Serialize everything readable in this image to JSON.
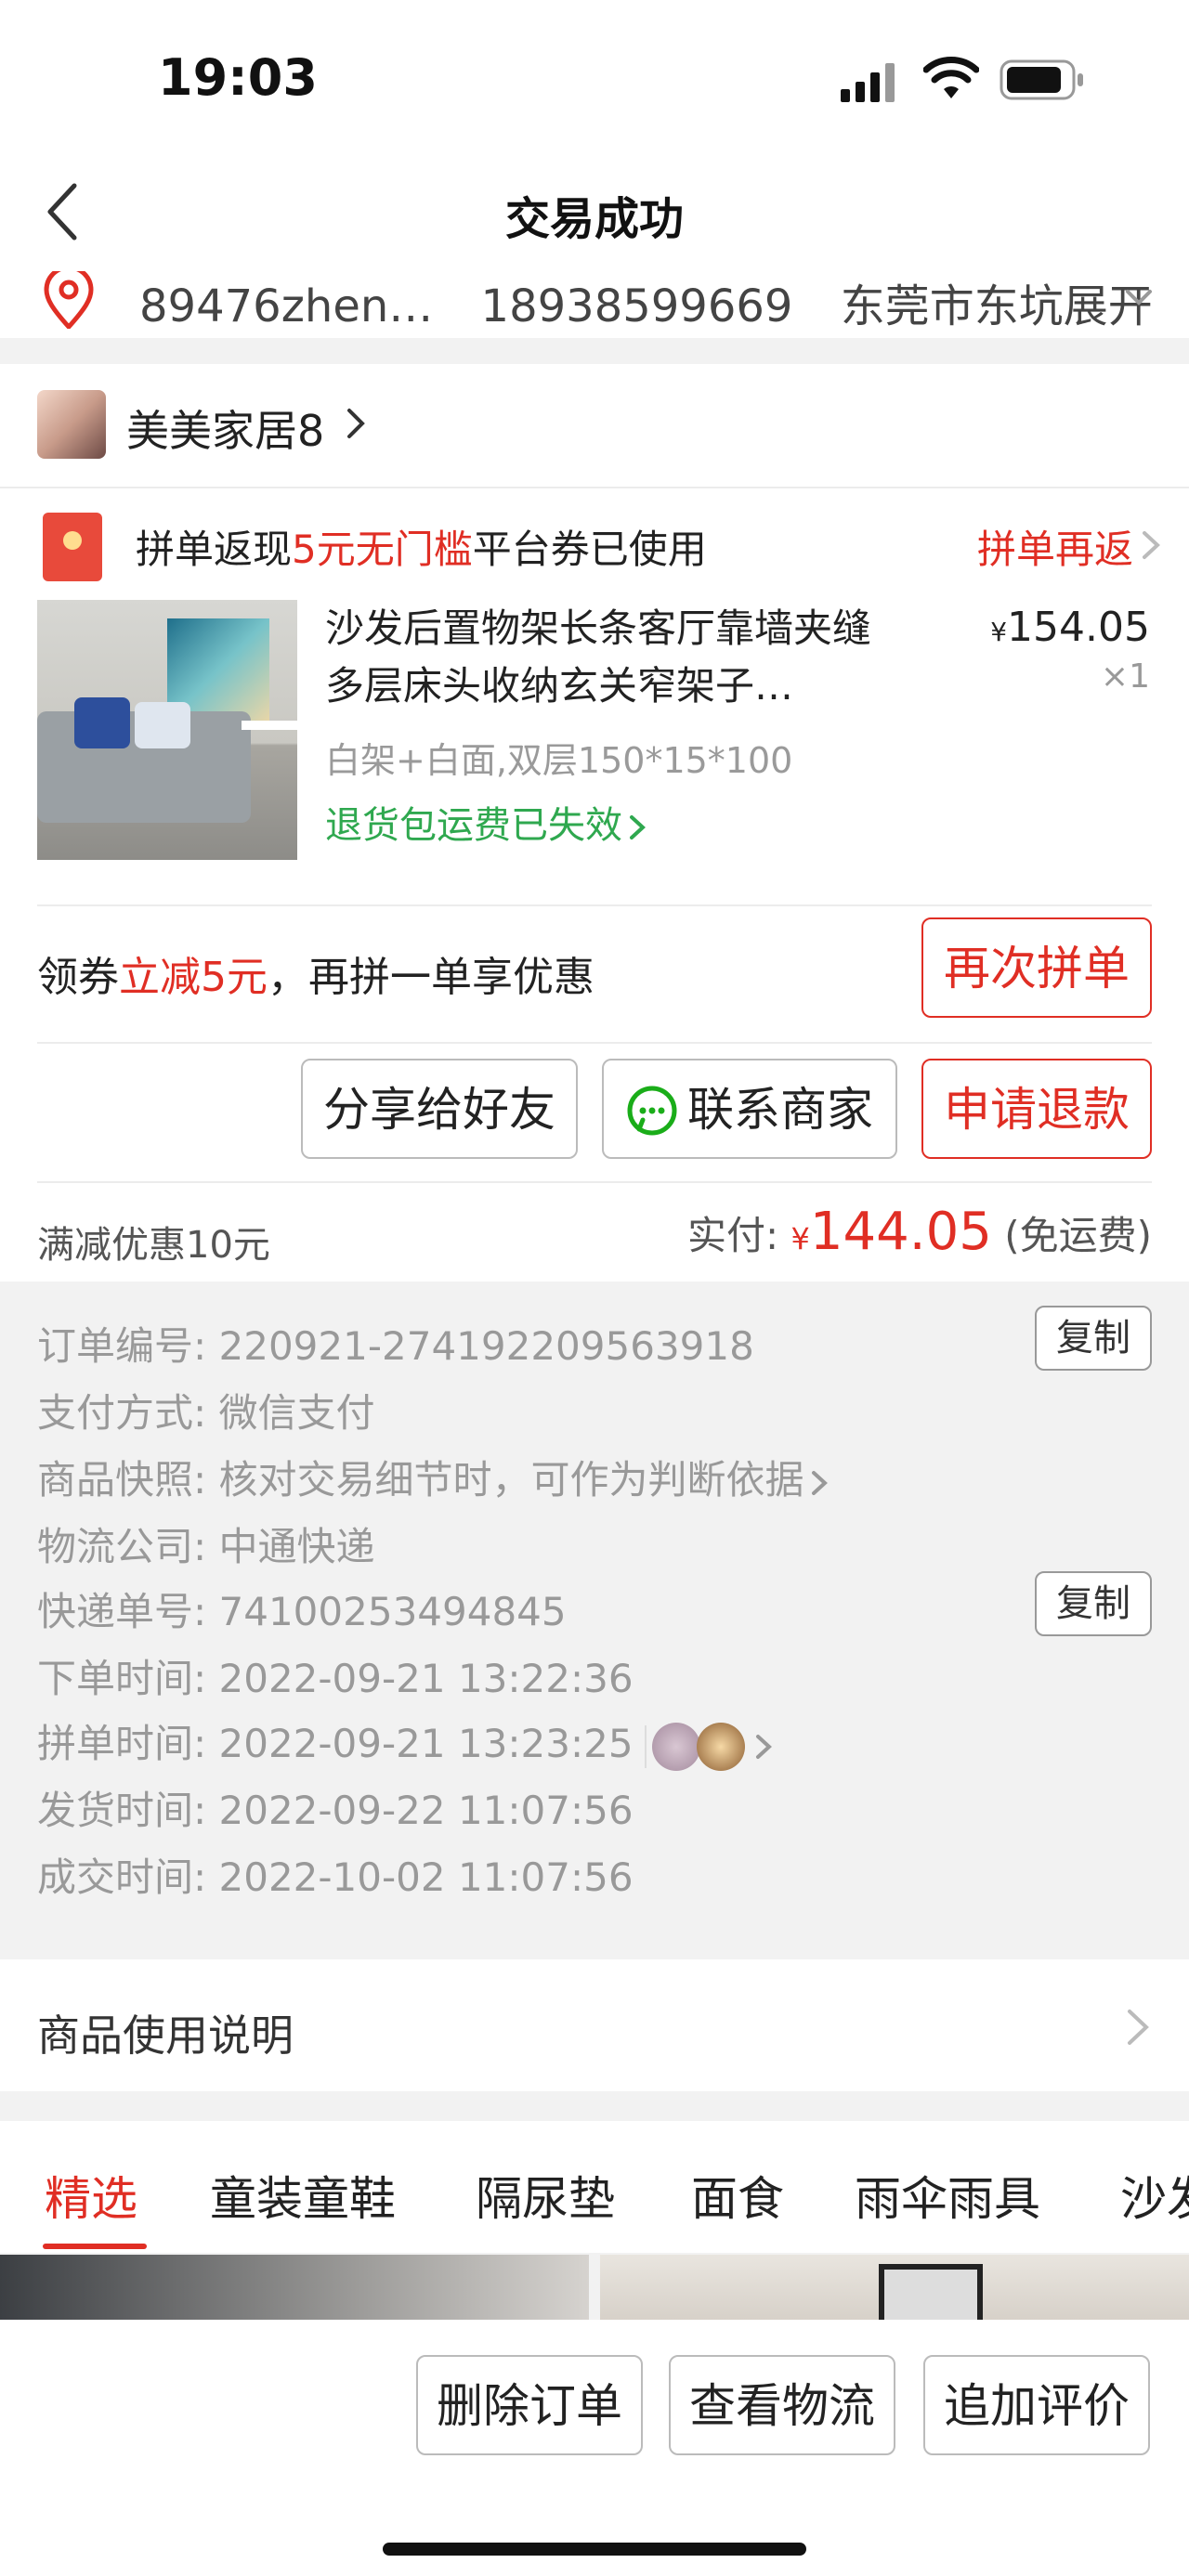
{
  "status": {
    "time": "19:03"
  },
  "nav": {
    "title": "交易成功"
  },
  "address": {
    "name": "89476zhen…",
    "phone": "18938599669",
    "location": "东莞市东坑展开"
  },
  "shop": {
    "name": "美美家居8"
  },
  "promo": {
    "text_pre": "拼单返现",
    "text_highlight": "5元无门槛",
    "text_post": "平台券已使用",
    "right_link": "拼单再返"
  },
  "product": {
    "title": "沙发后置物架长条客厅靠墙夹缝多层床头收纳玄关窄架子…",
    "price_symbol": "¥",
    "price": "154.05",
    "qty": "×1",
    "spec": "白架+白面,双层150*15*100",
    "return_note": "退货包运费已失效"
  },
  "coupon": {
    "pre": "领券",
    "highlight": "立减5元",
    "post": "，再拼一单享优惠",
    "button": "再次拼单"
  },
  "actions": {
    "share": "分享给好友",
    "contact": "联系商家",
    "refund": "申请退款"
  },
  "totals": {
    "discount": "满减优惠10元",
    "paid_label": "实付:",
    "yen": "¥",
    "amount": "144.05",
    "shipping": "(免运费)"
  },
  "details": {
    "order_no_label": "订单编号:",
    "order_no": "220921-274192209563918",
    "pay_label": "支付方式:",
    "pay": "微信支付",
    "snapshot_label": "商品快照:",
    "snapshot": "核对交易细节时，可作为判断依据",
    "logistics_label": "物流公司:",
    "logistics": "中通快递",
    "tracking_label": "快递单号:",
    "tracking": "74100253494845",
    "order_time_label": "下单时间:",
    "order_time": "2022-09-21 13:22:36",
    "group_time_label": "拼单时间:",
    "group_time": "2022-09-21 13:23:25",
    "ship_time_label": "发货时间:",
    "ship_time": "2022-09-22 11:07:56",
    "deal_time_label": "成交时间:",
    "deal_time": "2022-10-02 11:07:56",
    "copy": "复制"
  },
  "usage": {
    "label": "商品使用说明"
  },
  "tabs": [
    "精选",
    "童装童鞋",
    "隔尿垫",
    "面食",
    "雨伞雨具",
    "沙发"
  ],
  "bottom": {
    "delete": "删除订单",
    "logistics": "查看物流",
    "review": "追加评价"
  },
  "colors": {
    "accent": "#e02e24",
    "green": "#2fa84f",
    "wechat": "#1aad19"
  }
}
